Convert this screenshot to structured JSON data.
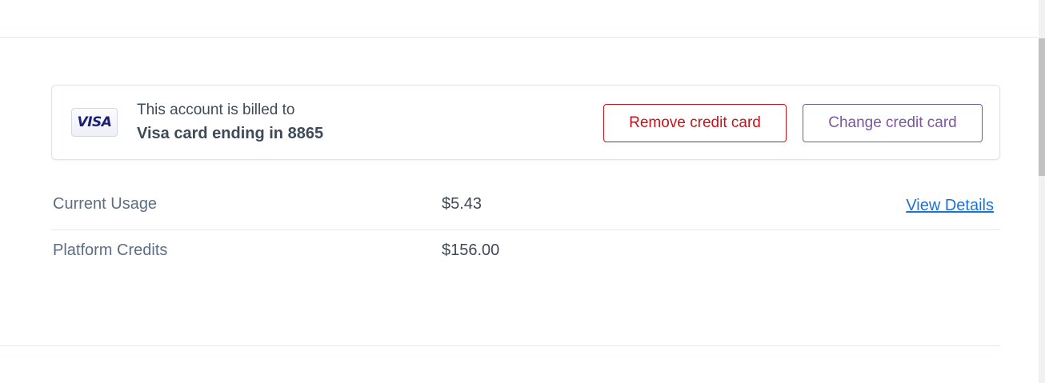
{
  "billing": {
    "card_brand": "VISA",
    "billed_label": "This account is billed to",
    "card_description": "Visa card ending in 8865",
    "remove_button_label": "Remove credit card",
    "change_button_label": "Change credit card"
  },
  "summary": {
    "rows": [
      {
        "label": "Current Usage",
        "value": "$5.43",
        "link": "View Details"
      },
      {
        "label": "Platform Credits",
        "value": "$156.00"
      }
    ]
  },
  "colors": {
    "remove_accent": "#c8131a",
    "change_accent": "#79589f",
    "link": "#1b73d6",
    "visa_brand": "#1a1f71"
  }
}
